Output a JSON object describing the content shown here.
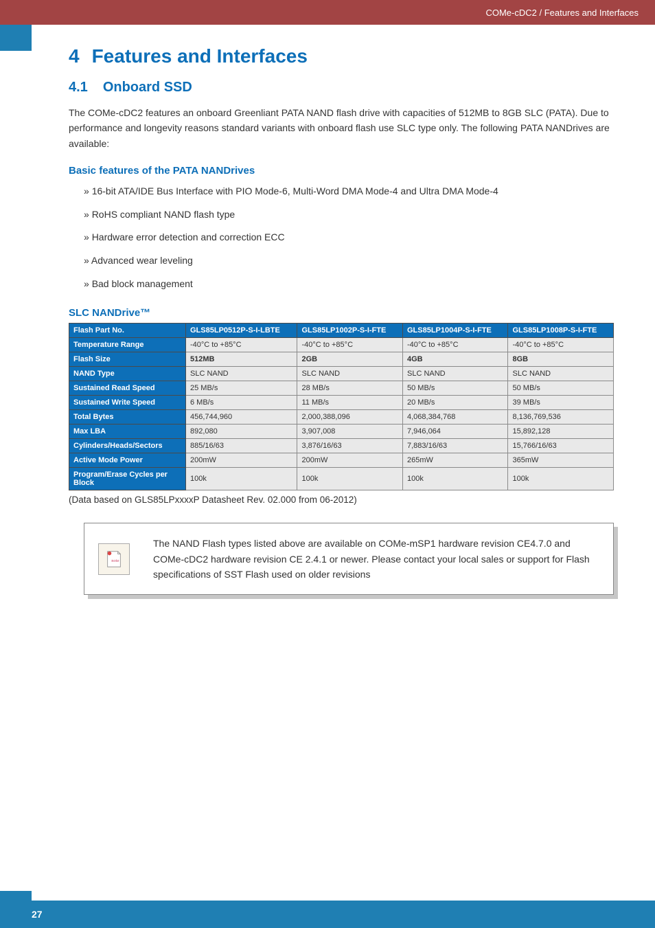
{
  "banner": {
    "breadcrumb": "COMe-cDC2 / Features and Interfaces"
  },
  "section": {
    "number": "4",
    "title": "Features and Interfaces"
  },
  "subsection": {
    "number": "4.1",
    "title": "Onboard SSD"
  },
  "intro_text": "The COMe-cDC2 features an onboard Greenliant PATA NAND flash drive with capacities of 512MB to 8GB SLC (PATA). Due to performance and longevity reasons standard variants with onboard flash use SLC type only. The following PATA NANDrives are available:",
  "features_heading": "Basic features of the PATA NANDrives",
  "features": [
    "16-bit ATA/IDE Bus Interface with PIO Mode-6, Multi-Word DMA Mode-4 and Ultra DMA Mode-4",
    "RoHS compliant NAND flash type",
    "Hardware error detection and correction ECC",
    "Advanced wear leveling",
    "Bad block management"
  ],
  "table_heading": "SLC NANDrive™",
  "table": {
    "row_labels": [
      "Flash Part No.",
      "Temperature Range",
      "Flash Size",
      "NAND Type",
      "Sustained Read Speed",
      "Sustained Write Speed",
      "Total Bytes",
      "Max LBA",
      "Cylinders/Heads/Sectors",
      "Active Mode Power",
      "Program/Erase Cycles per Block"
    ],
    "cols": [
      [
        "GLS85LP0512P-S-I-LBTE",
        "-40°C to +85°C",
        "512MB",
        "SLC NAND",
        "25 MB/s",
        "6 MB/s",
        "456,744,960",
        "892,080",
        "885/16/63",
        "200mW",
        "100k"
      ],
      [
        "GLS85LP1002P-S-I-FTE",
        "-40°C to +85°C",
        "2GB",
        "SLC NAND",
        "28 MB/s",
        "11 MB/s",
        "2,000,388,096",
        "3,907,008",
        "3,876/16/63",
        "200mW",
        "100k"
      ],
      [
        "GLS85LP1004P-S-I-FTE",
        "-40°C to +85°C",
        "4GB",
        "SLC NAND",
        "50 MB/s",
        "20 MB/s",
        "4,068,384,768",
        "7,946,064",
        "7,883/16/63",
        "265mW",
        "100k"
      ],
      [
        "GLS85LP1008P-S-I-FTE",
        "-40°C to +85°C",
        "8GB",
        "SLC NAND",
        "50 MB/s",
        "39 MB/s",
        "8,136,769,536",
        "15,892,128",
        "15,766/16/63",
        "365mW",
        "100k"
      ]
    ]
  },
  "table_caption": "(Data based on GLS85LPxxxxP Datasheet Rev. 02.000 from 06-2012)",
  "note_text": "The NAND Flash types listed above are available on COMe-mSP1 hardware revision CE4.7.0 and COMe-cDC2 hardware revision CE 2.4.1 or newer. Please contact your local sales or support for Flash specifications of SST Flash used on older revisions",
  "footer": {
    "page_number": "27"
  }
}
